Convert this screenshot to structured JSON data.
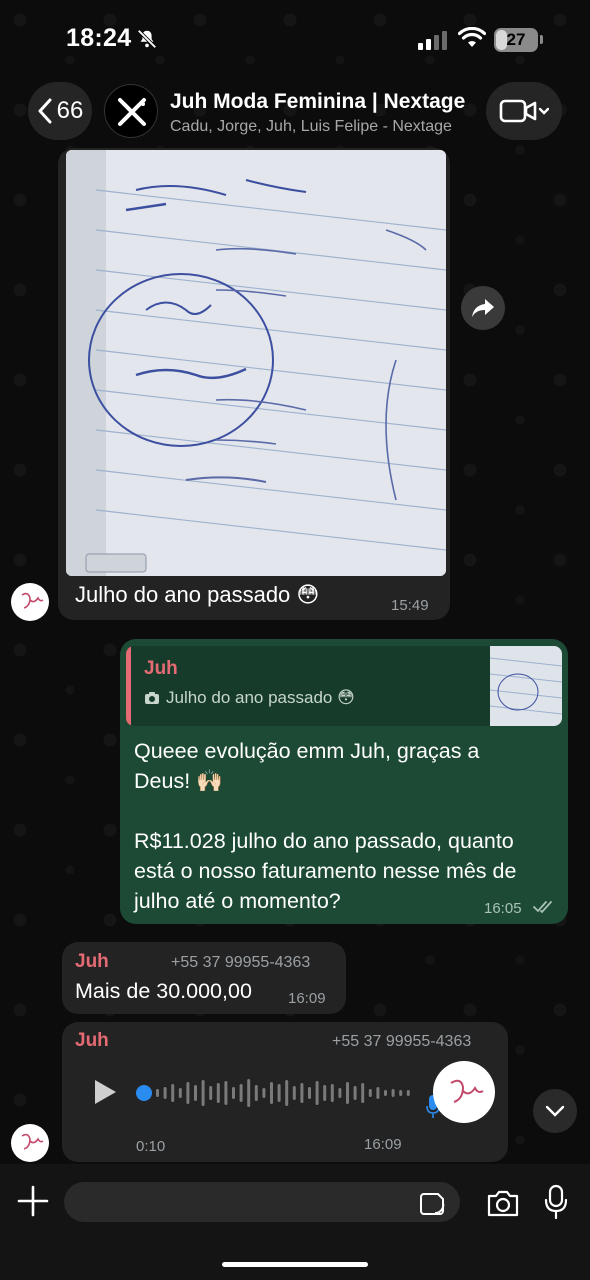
{
  "status_bar": {
    "time": "18:24",
    "battery": "27",
    "battery_level": 0.27
  },
  "header": {
    "back_count": "66",
    "title": "Juh Moda Feminina | Nextage",
    "subtitle": "Cadu, Jorge, Juh, Luis Felipe - Nextage"
  },
  "messages": [
    {
      "type": "image",
      "caption": "Julho do ano passado 😳",
      "time": "15:49"
    },
    {
      "type": "reply",
      "quote": {
        "sender": "Juh",
        "text": "Julho do ano passado 😳"
      },
      "lines": [
        "Queee evolução emm Juh, graças a",
        "Deus! 🙌🏻",
        "",
        "R$11.028 julho do ano passado, quanto",
        "está o nosso faturamento nesse mês de",
        "julho até o momento?"
      ],
      "time": "16:05"
    },
    {
      "type": "text",
      "sender": "Juh",
      "phone": "+55 37 99955-4363",
      "text": "Mais de 30.000,00",
      "time": "16:09"
    },
    {
      "type": "voice",
      "sender": "Juh",
      "phone": "+55 37 99955-4363",
      "duration": "0:10",
      "time": "16:09"
    }
  ],
  "icons": {
    "back": "chevron-left-icon",
    "video": "video-camera-icon",
    "forward": "forward-arrow-icon",
    "play": "play-icon",
    "mic": "microphone-icon",
    "camera": "camera-icon",
    "sticker": "sticker-icon",
    "plus": "plus-icon",
    "scroll": "chevron-down-icon"
  },
  "colors": {
    "outgoing_bubble": "#1c4a35",
    "incoming_bubble": "#232323",
    "sender_name": "#e46a73",
    "voice_progress": "#2a8cf0"
  }
}
